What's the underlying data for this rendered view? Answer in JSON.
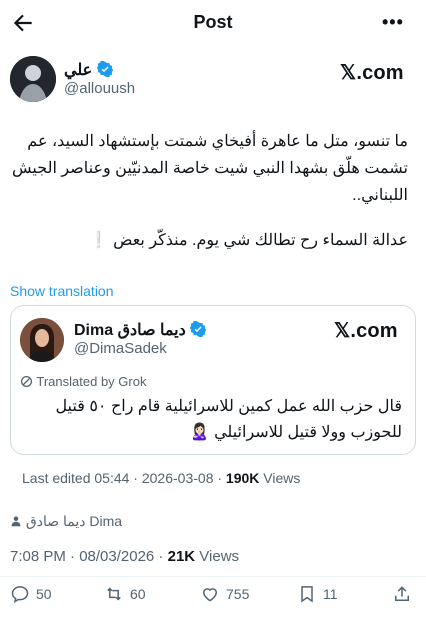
{
  "header": {
    "title": "Post"
  },
  "author": {
    "name": "علي",
    "handle": "@allouush",
    "source_label": "𝕏.com"
  },
  "tweet": {
    "text": "ما تنسو، متل ما عاهرة أفيخاي شمتت بإستشهاد السيد، عم تشمت هلّق بشهدا النبي شيت خاصة المدنيّين وعناصر الجيش اللبناني..",
    "text2": "عدالة السماء رح تطالك شي يوم. منذكّر بعض ❕"
  },
  "show_translation": "Show translation",
  "quote": {
    "name": "Dima ديما صادق",
    "handle": "@DimaSadek",
    "source_label": "𝕏.com",
    "translated_label": "Translated by Grok",
    "text": "قال حزب الله عمل كمين للاسرائيلية  قام راح ٥٠ قتيل للحوزب وولا قتيل للاسرائيلي 🙎🏻‍♀️"
  },
  "edited": {
    "prefix": "Last edited 05:44 · 2026-03-08 · ",
    "views_count": "190K",
    "views_label": " Views"
  },
  "credit": "ديما صادق Dima",
  "meta": {
    "time": "7:08 PM · 08/03/2026 · ",
    "views_count": "21K",
    "views_label": " Views"
  },
  "actions": {
    "replies": "50",
    "reposts": "60",
    "likes": "755",
    "bookmarks": "11"
  },
  "colors": {
    "accent": "#1d9bf0",
    "text": "#0f1419",
    "muted": "#536471",
    "border": "#cfd9de"
  }
}
